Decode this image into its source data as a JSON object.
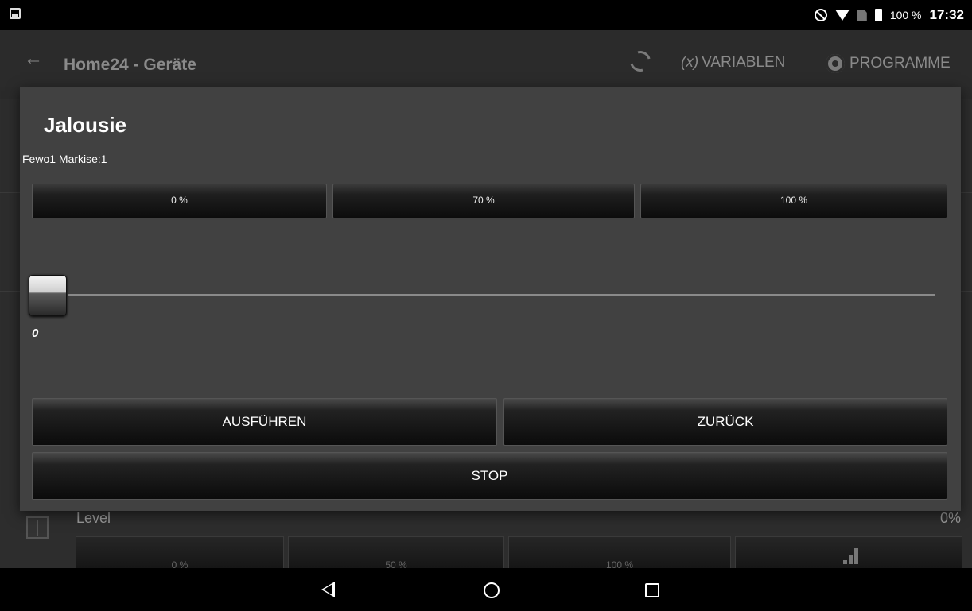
{
  "status_bar": {
    "battery_percent": "100 %",
    "time": "17:32"
  },
  "action_bar": {
    "title": "Home24 - Geräte",
    "variablen_icon": "(x)",
    "variablen_label": "VARIABLEN",
    "programme_label": "PROGRAMME"
  },
  "background": {
    "level_label": "Level",
    "level_value": "0%",
    "buttons": [
      "0 %",
      "50 %",
      "100 %"
    ]
  },
  "dialog": {
    "title": "Jalousie",
    "subtitle": "Fewo1 Markise:1",
    "presets": [
      "0 %",
      "70 %",
      "100 %"
    ],
    "slider_value": "0",
    "execute_label": "AUSFÜHREN",
    "back_label": "ZURÜCK",
    "stop_label": "STOP"
  },
  "icons": {
    "status_left": "image-icon",
    "dnd": "do-not-disturb-icon",
    "wifi": "wifi-icon",
    "sim": "no-sim-icon",
    "battery": "battery-icon",
    "back": "arrow-left-icon",
    "refresh": "refresh-icon",
    "programme": "gear-icon",
    "nav_back": "triangle-back-icon",
    "nav_home": "circle-home-icon",
    "nav_recent": "square-recent-icon"
  }
}
